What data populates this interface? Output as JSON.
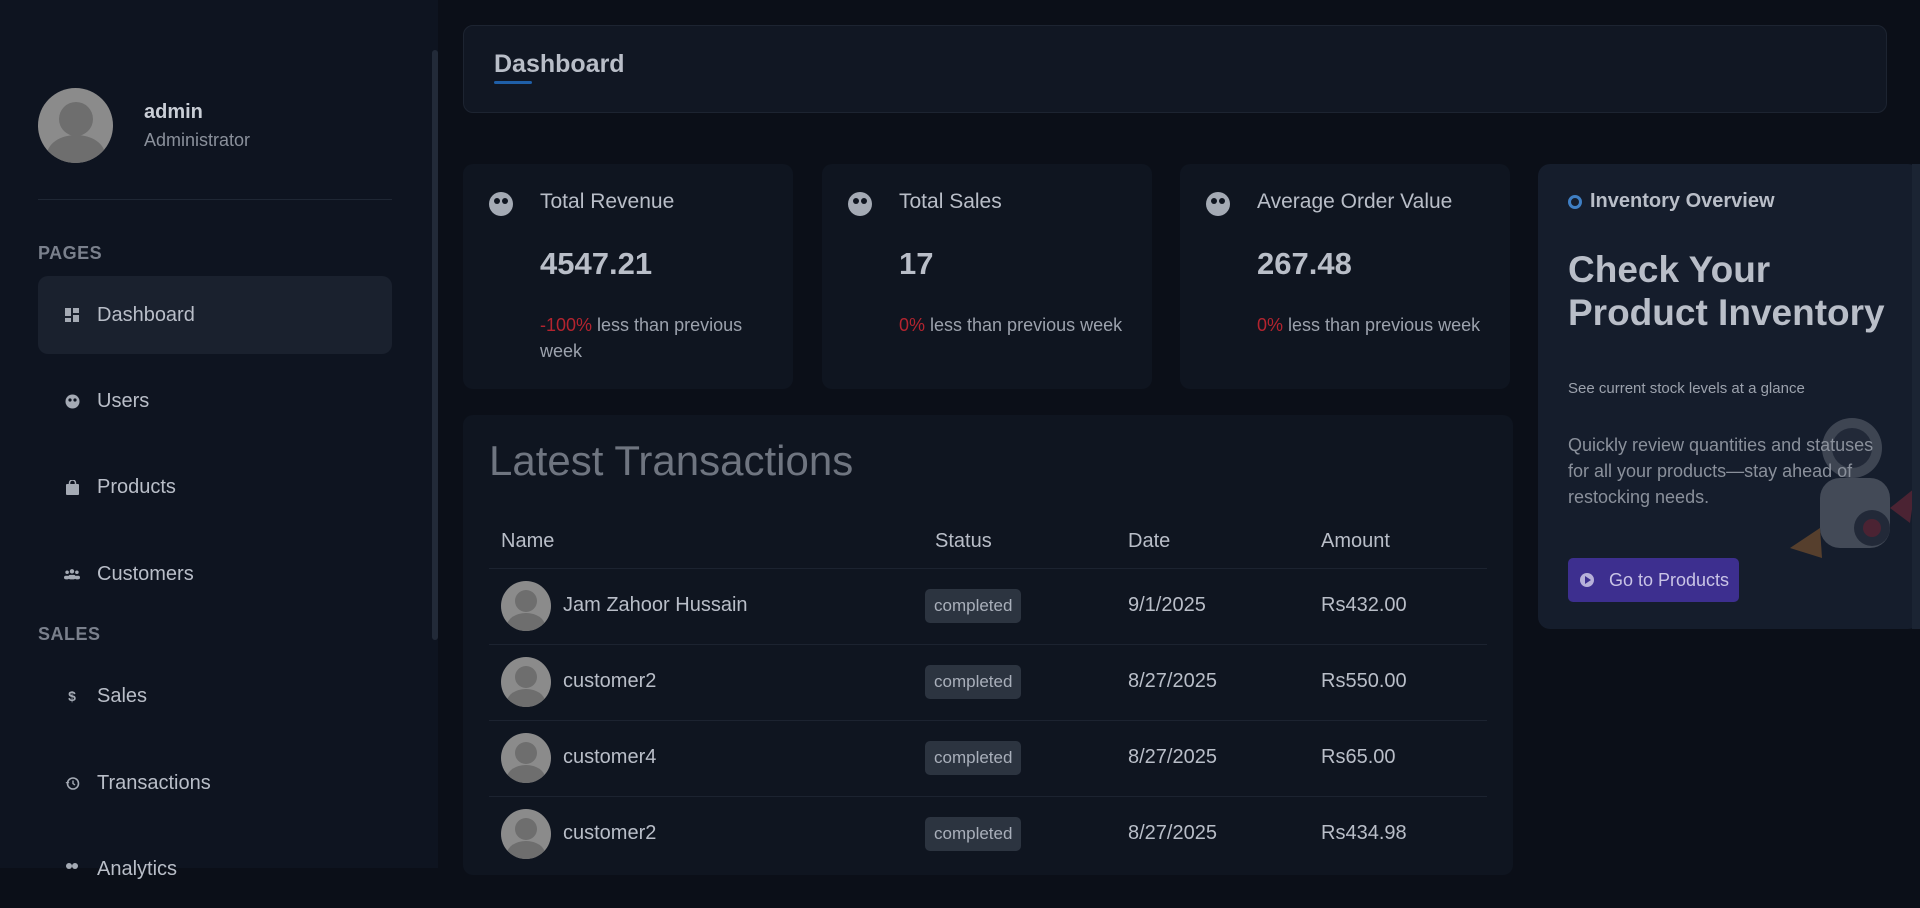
{
  "profile": {
    "name": "admin",
    "role": "Administrator"
  },
  "sidebar": {
    "sections": [
      "PAGES",
      "SALES"
    ],
    "items": [
      {
        "label": "Dashboard",
        "icon": "dashboard-icon"
      },
      {
        "label": "Users",
        "icon": "users-icon"
      },
      {
        "label": "Products",
        "icon": "bag-icon"
      },
      {
        "label": "Customers",
        "icon": "group-icon"
      },
      {
        "label": "Sales",
        "icon": "dollar-icon"
      },
      {
        "label": "Transactions",
        "icon": "history-icon"
      },
      {
        "label": "Analytics",
        "icon": "analytics-icon"
      }
    ]
  },
  "header": {
    "title": "Dashboard"
  },
  "stats": [
    {
      "title": "Total Revenue",
      "value": "4547.21",
      "change": "-100%",
      "suffix": " less than previous week"
    },
    {
      "title": "Total Sales",
      "value": "17",
      "change": "0%",
      "suffix": " less than previous week"
    },
    {
      "title": "Average Order Value",
      "value": "267.48",
      "change": "0%",
      "suffix": " less than previous week"
    }
  ],
  "inventory": {
    "label": "Inventory Overview",
    "heading": "Check Your Product Inventory",
    "sub": "See current stock levels at a glance",
    "desc": "Quickly review quantities and statuses for all your products—stay ahead of restocking needs.",
    "button": "Go to Products"
  },
  "transactions": {
    "title": "Latest Transactions",
    "headers": [
      "Name",
      "Status",
      "Date",
      "Amount"
    ],
    "rows": [
      {
        "name": "Jam Zahoor Hussain",
        "status": "completed",
        "date": "9/1/2025",
        "amount": "Rs432.00"
      },
      {
        "name": "customer2",
        "status": "completed",
        "date": "8/27/2025",
        "amount": "Rs550.00"
      },
      {
        "name": "customer4",
        "status": "completed",
        "date": "8/27/2025",
        "amount": "Rs65.00"
      },
      {
        "name": "customer2",
        "status": "completed",
        "date": "8/27/2025",
        "amount": "Rs434.98"
      }
    ]
  }
}
